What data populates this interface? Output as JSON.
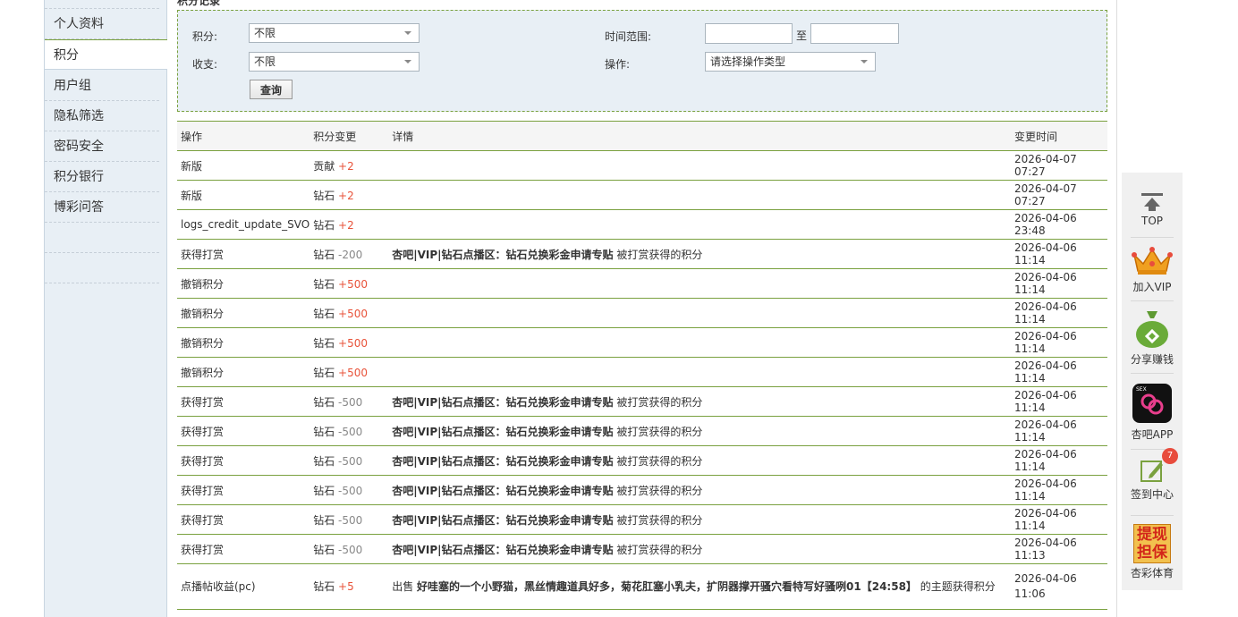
{
  "top_cut_text": "积分记录",
  "sidebar": {
    "items": [
      {
        "label": "个人资料"
      },
      {
        "label": "积分"
      },
      {
        "label": "用户组"
      },
      {
        "label": "隐私筛选"
      },
      {
        "label": "密码安全"
      },
      {
        "label": "积分银行"
      },
      {
        "label": "博彩问答"
      }
    ],
    "active_index": 1
  },
  "filter": {
    "credit_label": "积分:",
    "credit_value": "不限",
    "income_label": "收支:",
    "income_value": "不限",
    "time_label": "时间范围:",
    "time_from": "",
    "time_to": "",
    "time_sep": "至",
    "op_label": "操作:",
    "op_value": "请选择操作类型",
    "search_button": "查询"
  },
  "table": {
    "headers": [
      "操作",
      "积分变更",
      "详情",
      "变更时间"
    ],
    "rows": [
      {
        "op": "新版",
        "unit": "贡献",
        "delta": "+2",
        "thread": "",
        "suffix": "",
        "time": "2026-04-07 07:27"
      },
      {
        "op": "新版",
        "unit": "钻石",
        "delta": "+2",
        "thread": "",
        "suffix": "",
        "time": "2026-04-07 07:27"
      },
      {
        "op": "logs_credit_update_SVO",
        "unit": "钻石",
        "delta": "+2",
        "thread": "",
        "suffix": "",
        "time": "2026-04-06 23:48"
      },
      {
        "op": "获得打赏",
        "unit": "钻石",
        "delta": "-200",
        "thread": "杏吧|VIP|钻石点播区：钻石兑换彩金申请专贴",
        "suffix": " 被打赏获得的积分",
        "time": "2026-04-06 11:14"
      },
      {
        "op": "撤销积分",
        "unit": "钻石",
        "delta": "+500",
        "thread": "",
        "suffix": "",
        "time": "2026-04-06 11:14"
      },
      {
        "op": "撤销积分",
        "unit": "钻石",
        "delta": "+500",
        "thread": "",
        "suffix": "",
        "time": "2026-04-06 11:14"
      },
      {
        "op": "撤销积分",
        "unit": "钻石",
        "delta": "+500",
        "thread": "",
        "suffix": "",
        "time": "2026-04-06 11:14"
      },
      {
        "op": "撤销积分",
        "unit": "钻石",
        "delta": "+500",
        "thread": "",
        "suffix": "",
        "time": "2026-04-06 11:14"
      },
      {
        "op": "获得打赏",
        "unit": "钻石",
        "delta": "-500",
        "thread": "杏吧|VIP|钻石点播区：钻石兑换彩金申请专贴",
        "suffix": " 被打赏获得的积分",
        "time": "2026-04-06 11:14"
      },
      {
        "op": "获得打赏",
        "unit": "钻石",
        "delta": "-500",
        "thread": "杏吧|VIP|钻石点播区：钻石兑换彩金申请专贴",
        "suffix": " 被打赏获得的积分",
        "time": "2026-04-06 11:14"
      },
      {
        "op": "获得打赏",
        "unit": "钻石",
        "delta": "-500",
        "thread": "杏吧|VIP|钻石点播区：钻石兑换彩金申请专贴",
        "suffix": " 被打赏获得的积分",
        "time": "2026-04-06 11:14"
      },
      {
        "op": "获得打赏",
        "unit": "钻石",
        "delta": "-500",
        "thread": "杏吧|VIP|钻石点播区：钻石兑换彩金申请专贴",
        "suffix": " 被打赏获得的积分",
        "time": "2026-04-06 11:14"
      },
      {
        "op": "获得打赏",
        "unit": "钻石",
        "delta": "-500",
        "thread": "杏吧|VIP|钻石点播区：钻石兑换彩金申请专贴",
        "suffix": " 被打赏获得的积分",
        "time": "2026-04-06 11:14"
      },
      {
        "op": "获得打赏",
        "unit": "钻石",
        "delta": "-500",
        "thread": "杏吧|VIP|钻石点播区：钻石兑换彩金申请专贴",
        "suffix": " 被打赏获得的积分",
        "time": "2026-04-06 11:13"
      },
      {
        "op": "点播帖收益(pc)",
        "unit": "钻石",
        "delta": "+5",
        "prefix": "出售 ",
        "thread": "好哇塞的一个小野猫，黑丝情趣道具好多，菊花肛塞小乳夫，扩阴器撑开骚穴看特写好骚咧01【24:58】",
        "suffix": " 的主题获得积分",
        "time": "2026-04-06 11:06"
      }
    ]
  },
  "floatbar": {
    "top_label": "TOP",
    "vip_label": "加入VIP",
    "share_label": "分享赚钱",
    "app_label": "杏吧APP",
    "app_icon_text": "SEX",
    "checkin_label": "签到中心",
    "checkin_badge": "7",
    "guarantee_label": "杏彩体育",
    "guarantee_icon_line1": "提现",
    "guarantee_icon_line2": "担保"
  },
  "colors": {
    "accent_green": "#7aa13f",
    "delta_positive": "#e8533a",
    "delta_negative": "#888888",
    "sidebar_bg": "#e8eff5"
  }
}
